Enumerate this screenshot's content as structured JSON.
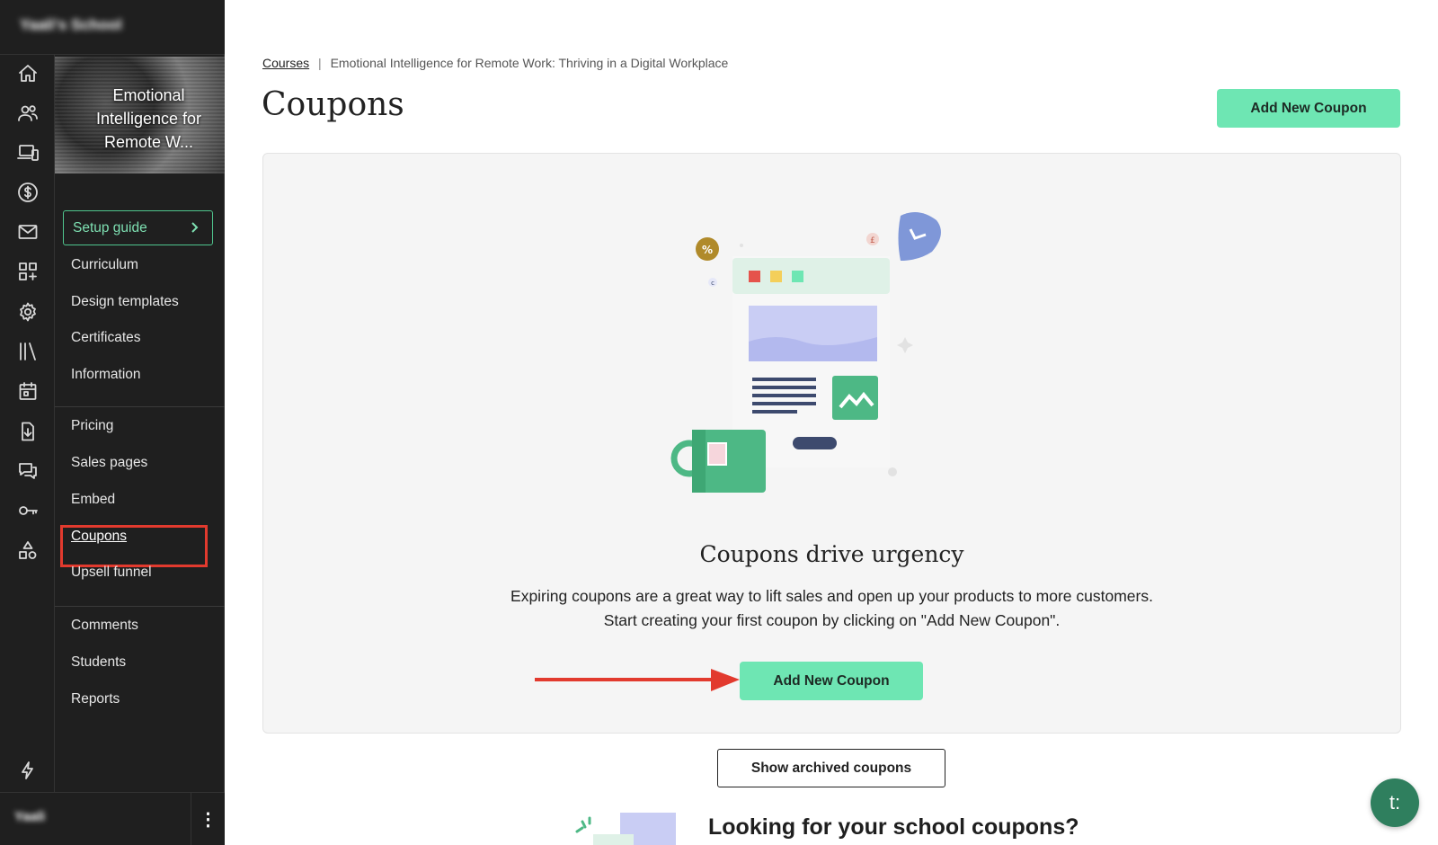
{
  "school": {
    "name": "Yaali's School",
    "user": "Yaali"
  },
  "rail": {
    "icons": [
      "home-icon",
      "users-icon",
      "devices-icon",
      "dollar-icon",
      "mail-icon",
      "apps-icon",
      "gear-icon",
      "library-icon",
      "calendar-icon",
      "download-doc-icon",
      "comments-icon",
      "key-icon",
      "shapes-icon",
      "lightning-icon"
    ]
  },
  "course": {
    "title": "Emotional Intelligence for Remote W..."
  },
  "sidebar": {
    "setup_guide": "Setup guide",
    "group1": [
      "Curriculum",
      "Design templates",
      "Certificates",
      "Information"
    ],
    "group2": [
      "Pricing",
      "Sales pages",
      "Embed",
      "Coupons",
      "Upsell funnel"
    ],
    "group3": [
      "Comments",
      "Students",
      "Reports"
    ],
    "active": "Coupons"
  },
  "breadcrumb": {
    "link": "Courses",
    "separator": "|",
    "current": "Emotional Intelligence for Remote Work: Thriving in a Digital Workplace"
  },
  "page": {
    "title": "Coupons",
    "add_button": "Add New Coupon"
  },
  "empty_state": {
    "title": "Coupons drive urgency",
    "line1": "Expiring coupons are a great way to lift sales and open up your products to more customers.",
    "line2": "Start creating your first coupon by clicking on \"Add New Coupon\".",
    "add_button": "Add New Coupon"
  },
  "archived_button": "Show archived coupons",
  "school_coupons": {
    "heading": "Looking for your school coupons?"
  },
  "chat": {
    "label": "t:"
  },
  "colors": {
    "accent": "#6ee6b3",
    "sidebar_bg": "#1f1f1f",
    "highlight": "#e23a2e"
  }
}
